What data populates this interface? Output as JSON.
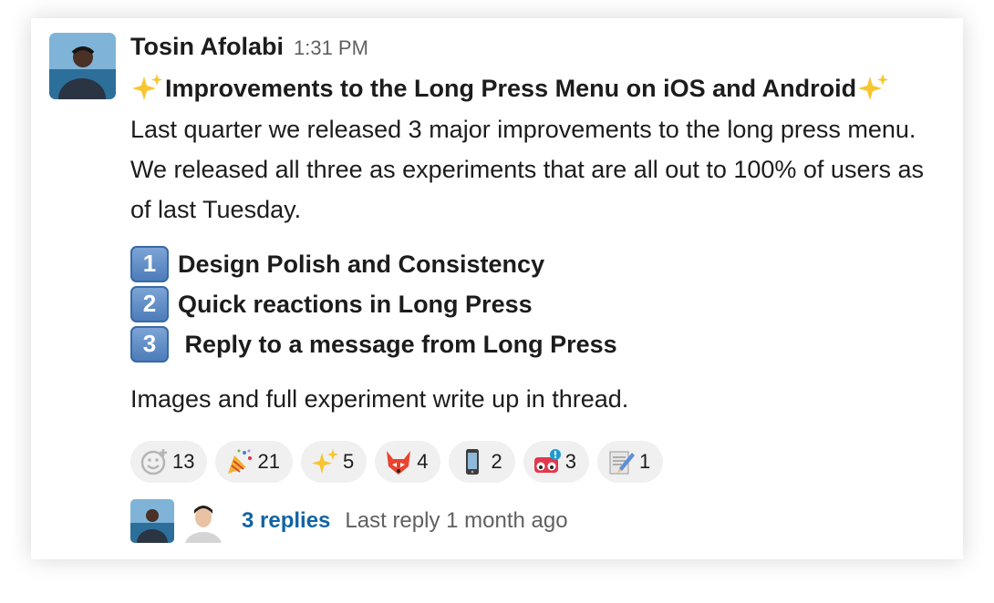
{
  "message": {
    "author": "Tosin Afolabi",
    "time": "1:31 PM",
    "title": "Improvements to the Long Press Menu on iOS and Android",
    "body": "Last quarter we released 3 major improvements to the long press menu. We released all three as experiments that are all out to 100% of users as of last Tuesday.",
    "list": [
      {
        "num": "1",
        "text": "Design Polish and Consistency"
      },
      {
        "num": "2",
        "text": "Quick reactions in Long Press"
      },
      {
        "num": "3",
        "text": " Reply to a message from Long Press"
      }
    ],
    "footer": "Images and full experiment write up in thread."
  },
  "reactions": [
    {
      "icon": "add-reaction-icon",
      "count": "13"
    },
    {
      "icon": "party-popper-icon",
      "count": "21"
    },
    {
      "icon": "sparkles-icon",
      "count": "5"
    },
    {
      "icon": "fox-icon",
      "count": "4"
    },
    {
      "icon": "mobile-phone-icon",
      "count": "2"
    },
    {
      "icon": "notification-eyes-icon",
      "count": "3"
    },
    {
      "icon": "memo-icon",
      "count": "1"
    }
  ],
  "thread": {
    "replies_label": "3 replies",
    "last_reply": "Last reply 1 month ago"
  },
  "colors": {
    "link": "#1264a3",
    "muted": "#616061",
    "pill_bg": "#f0f0f0",
    "keycap": "#4b7ab8"
  }
}
